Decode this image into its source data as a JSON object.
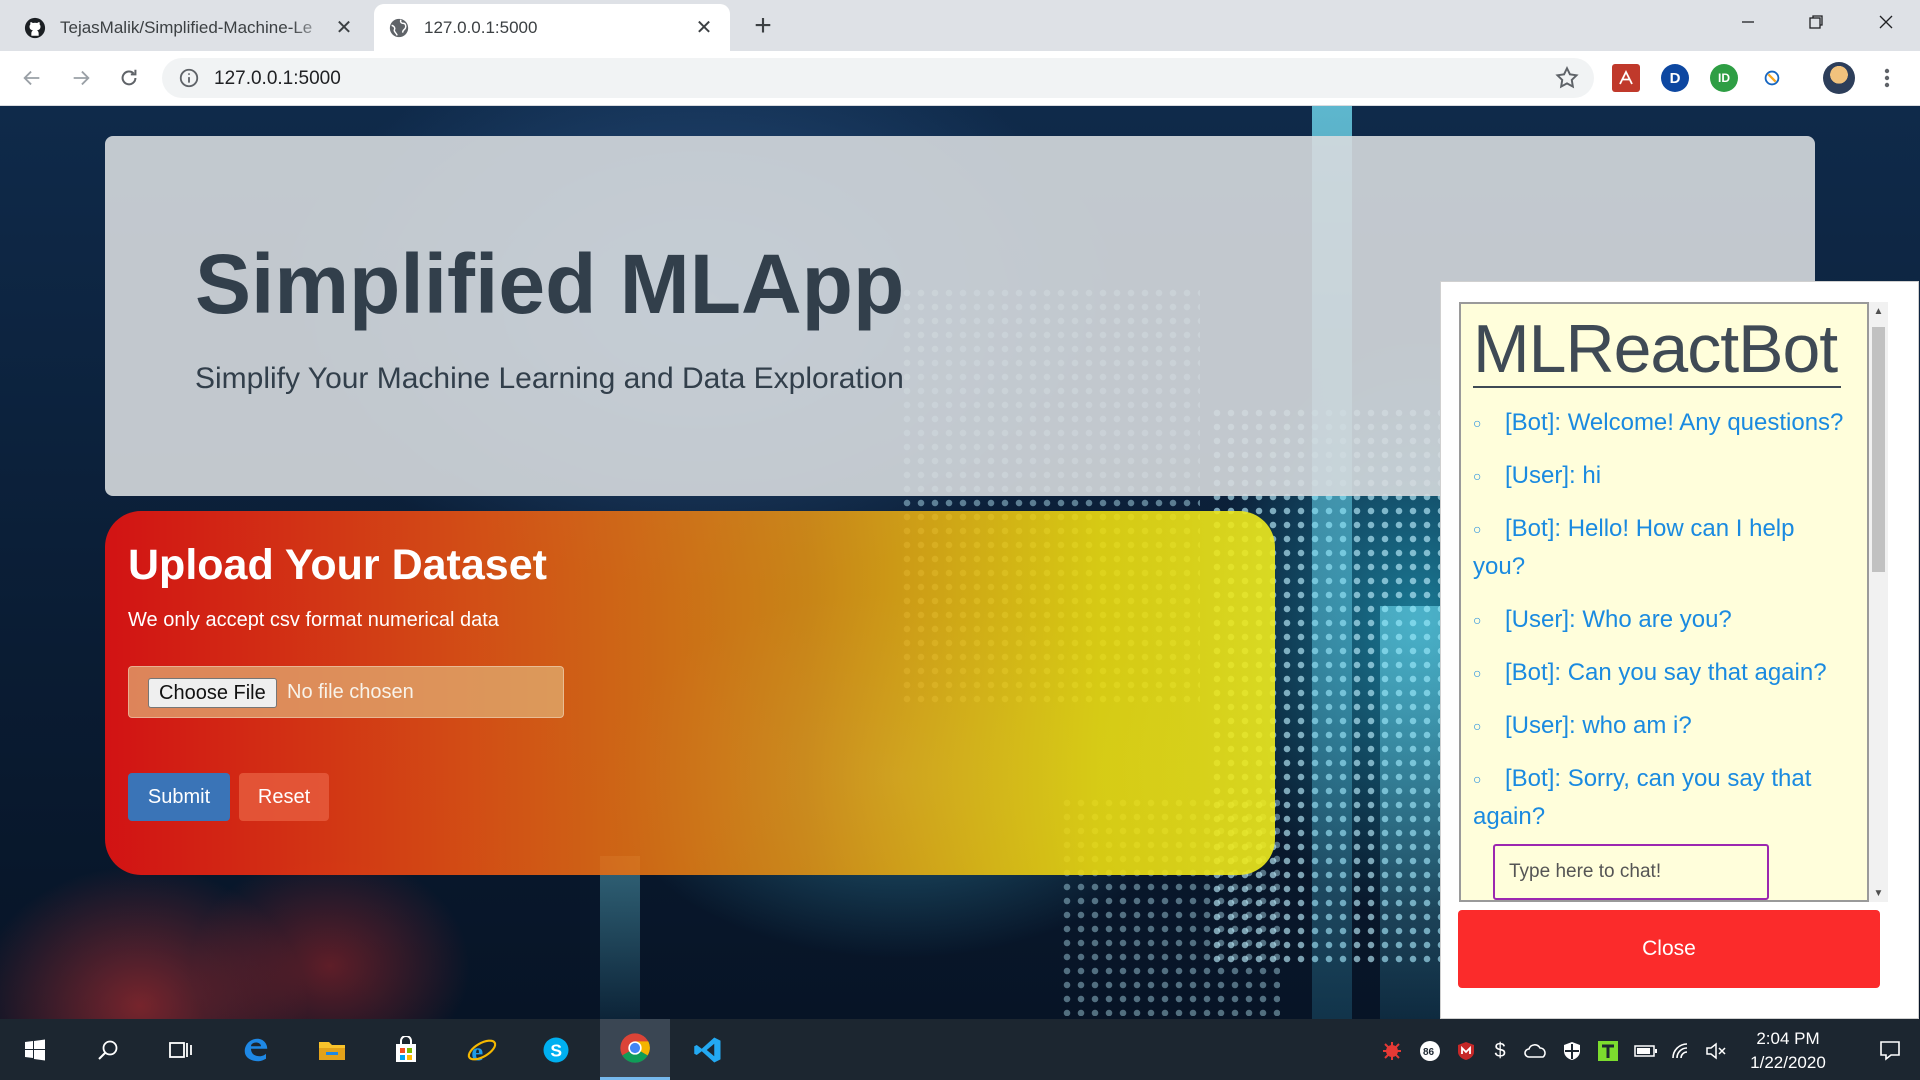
{
  "browser": {
    "tabs": [
      {
        "title": "TejasMalik/Simplified-Machine-Le",
        "icon": "github-icon",
        "close": "✕"
      },
      {
        "title": "127.0.0.1:5000",
        "icon": "globe-icon",
        "close": "✕"
      }
    ],
    "new_tab": "+",
    "url": "127.0.0.1:5000",
    "window_controls": [
      "minimize-icon",
      "restore-icon",
      "close-icon"
    ],
    "extensions": [
      {
        "name": "pdf-extension-icon",
        "label": "",
        "color": "#c0392b"
      },
      {
        "name": "dashlane-extension-icon",
        "label": "D",
        "color": "#0d47a1"
      },
      {
        "name": "id-extension-icon",
        "label": "ID",
        "color": "#2e9e44"
      },
      {
        "name": "sync-extension-icon",
        "label": "",
        "color": "#f5a623"
      }
    ]
  },
  "hero": {
    "title": "Simplified MLApp",
    "subtitle": "Simplify Your Machine Learning and Data Exploration"
  },
  "upload": {
    "title": "Upload Your Dataset",
    "subtitle": "We only accept csv format numerical data",
    "choose_file": "Choose File",
    "file_status": "No file chosen",
    "submit": "Submit",
    "reset": "Reset"
  },
  "chatbot": {
    "title": "MLReactBot",
    "messages": [
      "[Bot]: Welcome! Any questions?",
      "[User]: hi",
      "[Bot]: Hello! How can I help you?",
      "[User]: Who are you?",
      "[Bot]: Can you say that again?",
      "[User]: who am i?",
      "[Bot]: Sorry, can you say that again?"
    ],
    "input_placeholder": "Type here to chat!",
    "close": "Close"
  },
  "taskbar": {
    "time": "2:04 PM",
    "date": "1/22/2020"
  },
  "colors": {
    "accent_blue": "#3a74b7",
    "close_red": "#fb2b2b",
    "chat_text": "#1a8ae0",
    "chat_bg": "#fffedb"
  }
}
